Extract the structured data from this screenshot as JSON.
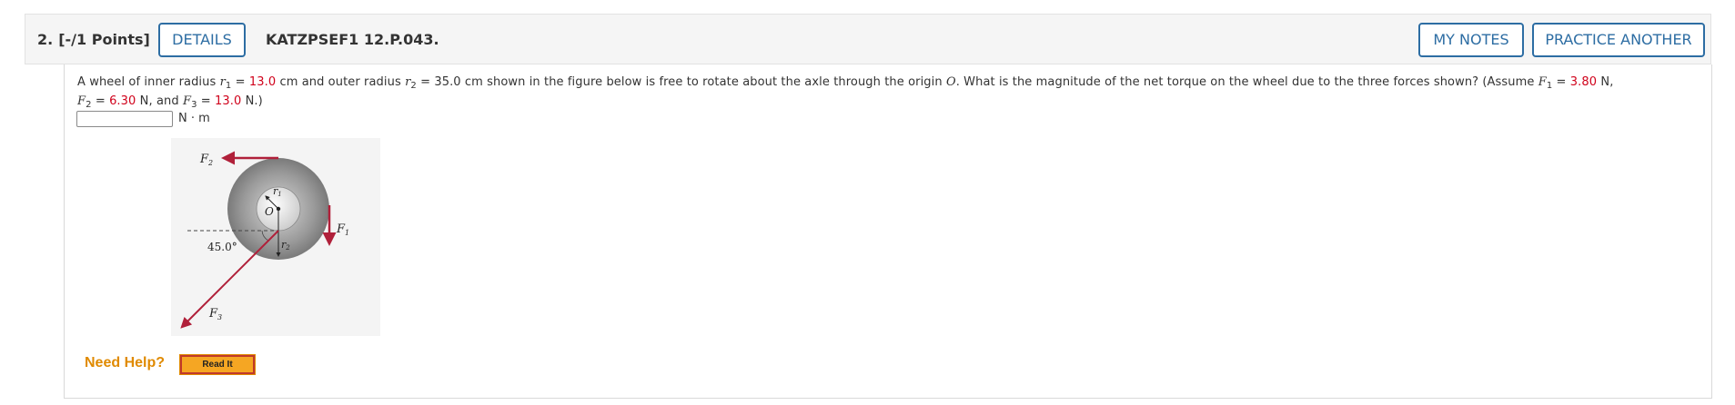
{
  "header": {
    "question_number": "2.",
    "points": "[-/1 Points]",
    "details_label": "DETAILS",
    "question_code": "KATZPSEF1 12.P.043.",
    "my_notes_label": "MY NOTES",
    "practice_label": "PRACTICE ANOTHER",
    "button_color": "#2d6da3"
  },
  "question": {
    "t1": "A wheel of inner radius ",
    "r1_sym": "r",
    "r1_sub": "1",
    "eq": " = ",
    "r1_val": "13.0",
    "t2": " cm  and outer radius ",
    "r2_sym": "r",
    "r2_sub": "2",
    "t3": " = 35.0 cm  shown in the figure below is free to rotate about the axle through the origin ",
    "origin": "O",
    "t4": ". What is the magnitude of the net torque on the wheel due to the three forces shown? (Assume ",
    "f1_sym": "F",
    "f1_sub": "1",
    "f1_val": "3.80",
    "n_comma": " N,",
    "f2_sym": "F",
    "f2_sub": "2",
    "f2_val": "6.30",
    "t5": " N,  and ",
    "f3_sym": "F",
    "f3_sub": "3",
    "f3_val": "13.0",
    "t6": " N.)",
    "highlight_color": "#d0021b"
  },
  "answer": {
    "value": "",
    "unit": "N · m"
  },
  "figure": {
    "f1": "F",
    "f1_sub": "1",
    "f2": "F",
    "f2_sub": "2",
    "f3": "F",
    "f3_sub": "3",
    "r1": "r",
    "r1_sub": "1",
    "r2": "r",
    "r2_sub": "2",
    "origin": "O",
    "angle": "45.0°",
    "arrow_color": "#b0203a"
  },
  "help": {
    "label": "Need Help?",
    "read_it": "Read It",
    "label_color": "#e08a00"
  }
}
